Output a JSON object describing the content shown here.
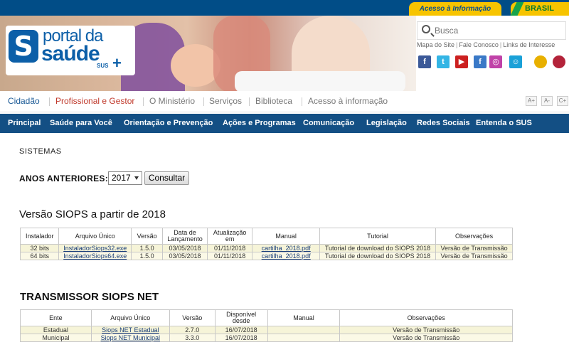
{
  "govbar": {
    "acesso": "Acesso à Informação",
    "brasil": "BRASIL"
  },
  "header": {
    "logo": {
      "s": "S",
      "line1": "portal da",
      "line2": "saúde",
      "sus": "SUS",
      "plus": "+"
    },
    "search_placeholder": "Busca",
    "toplinks": [
      "Mapa do Site",
      "Fale Conosco",
      "Links de Interesse"
    ]
  },
  "social": [
    {
      "name": "facebook-icon",
      "glyph": "f",
      "color": "#3b5998"
    },
    {
      "name": "twitter-icon",
      "glyph": "t",
      "color": "#33b5e5"
    },
    {
      "name": "youtube-icon",
      "glyph": "▶",
      "color": "#cc2020"
    },
    {
      "name": "flickr-icon",
      "glyph": "f",
      "color": "#3a79c7"
    },
    {
      "name": "instagram-icon",
      "glyph": "◎",
      "color": "#c042a8"
    },
    {
      "name": "chat-icon",
      "glyph": "☺",
      "color": "#1aa1d8"
    },
    {
      "name": "spanish-flag-icon",
      "glyph": "",
      "color": "#e8b000"
    },
    {
      "name": "english-flag-icon",
      "glyph": "",
      "color": "#b3233a"
    }
  ],
  "mainnav": {
    "items": [
      "Cidadão",
      "Profissional e Gestor",
      "O Ministério",
      "Serviços",
      "Biblioteca",
      "Acesso à informação"
    ],
    "colors": [
      "#1a5a96",
      "#c0392b",
      "#777777",
      "#777777",
      "#777777",
      "#777777"
    ],
    "font_buttons": [
      "A+",
      "A-",
      "C+"
    ]
  },
  "subnav": {
    "items": [
      "Principal",
      "Saúde para Você",
      "Orientação e Prevenção",
      "Ações e Programas",
      "Comunicação",
      "Legislação",
      "Redes Sociais",
      "Entenda o SUS"
    ]
  },
  "main": {
    "sistemas": "SISTEMAS",
    "anos_label": "ANOS ANTERIORES:",
    "year": "2017",
    "consultar": "Consultar",
    "siops_title": "Versão SIOPS a partir de 2018",
    "siops_headers": [
      "Instalador",
      "Arquivo Único",
      "Versão",
      "Data de Lançamento",
      "Atualização em",
      "Manual",
      "Tutorial",
      "Observações"
    ],
    "siops_rows": [
      [
        "32 bits",
        "InstaladorSiops32.exe",
        "1.5.0",
        "03/05/2018",
        "01/11/2018",
        "cartilha_2018.pdf",
        "Tutorial de download do SIOPS 2018",
        "Versão de Transmissão"
      ],
      [
        "64 bits",
        "InstaladorSiops64.exe",
        "1.5.0",
        "03/05/2018",
        "01/11/2018",
        "cartilha_2018.pdf",
        "Tutorial de download do SIOPS 2018",
        "Versão de Transmissão"
      ]
    ],
    "net_title": "TRANSMISSOR SIOPS NET",
    "net_headers": [
      "Ente",
      "Arquivo Único",
      "Versão",
      "Disponível desde",
      "Manual",
      "Observações"
    ],
    "net_rows": [
      [
        "Estadual",
        "Siops NET Estadual",
        "2.7.0",
        "16/07/2018",
        "",
        "Versão de Transmissão"
      ],
      [
        "Municipal",
        "Siops NET Municipal",
        "3.3.0",
        "16/07/2018",
        "",
        "Versão de Transmissão"
      ]
    ]
  }
}
